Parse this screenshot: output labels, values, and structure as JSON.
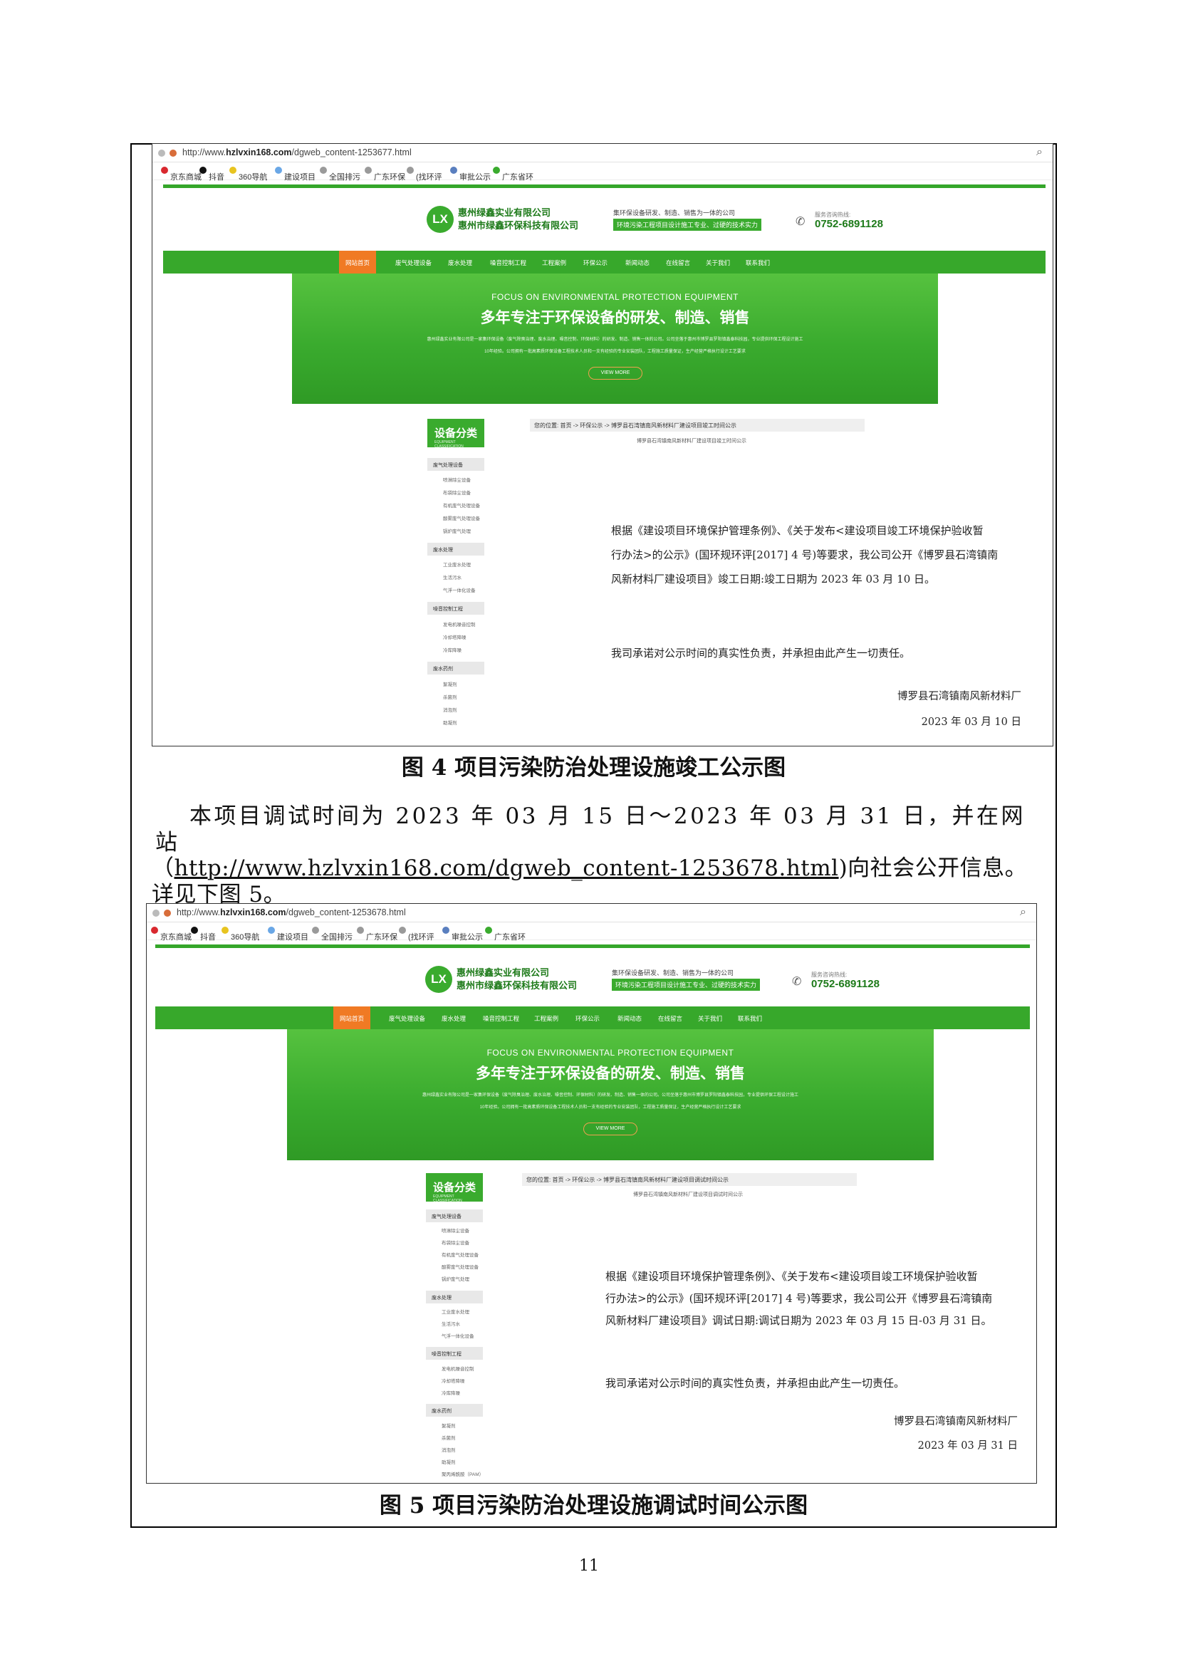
{
  "fig4": {
    "url_prefix": "http://www.",
    "url_domain": "hzlvxin168.com",
    "url_path": "/dgweb_content-1253677.html",
    "company_name_1": "惠州绿鑫实业有限公司",
    "company_name_2": "惠州市绿鑫环保科技有限公司",
    "slogan": "集环保设备研发、制造、销售为一体的公司",
    "slogan_bar": "环境污染工程项目设计施工专业、过硬的技术实力",
    "phone_label": "服务咨询热线:",
    "phone": "0752-6891128",
    "banner_en": "FOCUS ON ENVIRONMENTAL PROTECTION EQUIPMENT",
    "banner_cn": "多年专注于环保设备的研发、制造、销售",
    "view_more": "VIEW MORE",
    "crumb": "您的位置: 首页 -> 环保公示 -> 博罗县石湾镇南风新材料厂建设项目竣工时间公示",
    "subtitle": "博罗县石湾镇南风新材料厂建设项目竣工时间公示",
    "notice_1": "根据《建设项目环境保护管理条例》、《关于发布<建设项目竣工环境保护验收暂",
    "notice_2": "行办法>的公示》(国环规环评[2017] 4 号)等要求，我公司公开《博罗县石湾镇南",
    "notice_3": "风新材料厂建设项目》竣工日期:竣工日期为 2023 年 03 月 10 日。",
    "promise": "我司承诺对公示时间的真实性负责，并承担由此产生一切责任。",
    "sign_company": "博罗县石湾镇南风新材料厂",
    "sign_date": "2023 年 03 月 10 日",
    "caption": "图 4 项目污染防治处理设施竣工公示图"
  },
  "fig5": {
    "url_prefix": "http://www.",
    "url_domain": "hzlvxin168.com",
    "url_path": "/dgweb_content-1253678.html",
    "company_name_1": "惠州绿鑫实业有限公司",
    "company_name_2": "惠州市绿鑫环保科技有限公司",
    "slogan": "集环保设备研发、制造、销售为一体的公司",
    "slogan_bar": "环境污染工程项目设计施工专业、过硬的技术实力",
    "phone_label": "服务咨询热线:",
    "phone": "0752-6891128",
    "banner_en": "FOCUS ON ENVIRONMENTAL PROTECTION EQUIPMENT",
    "banner_cn": "多年专注于环保设备的研发、制造、销售",
    "view_more": "VIEW MORE",
    "crumb": "您的位置: 首页 -> 环保公示 -> 博罗县石湾镇南风新材料厂建设项目调试时间公示",
    "subtitle": "博罗县石湾镇南风新材料厂建设项目调试时间公示",
    "notice_1": "根据《建设项目环境保护管理条例》、《关于发布<建设项目竣工环境保护验收暂",
    "notice_2": "行办法>的公示》(国环规环评[2017] 4 号)等要求，我公司公开《博罗县石湾镇南",
    "notice_3": "风新材料厂建设项目》调试日期:调试日期为 2023 年 03 月 15 日-03 月 31 日。",
    "promise": "我司承诺对公示时间的真实性负责，并承担由此产生一切责任。",
    "sign_company": "博罗县石湾镇南风新材料厂",
    "sign_date": "2023 年 03 月 31 日",
    "caption": "图 5 项目污染防治处理设施调试时间公示图"
  },
  "bookmarks": [
    "京东商城",
    "抖音",
    "360导航",
    "建设项目",
    "全国排污",
    "广东环保",
    "(找环评",
    "审批公示",
    "广东省环"
  ],
  "nav_items": [
    "网站首页",
    "废气处理设备",
    "废水处理",
    "噪音控制工程",
    "工程案例",
    "环保公示",
    "新闻动态",
    "在线留言",
    "关于我们",
    "联系我们"
  ],
  "banner_desc_1": "惠州绿鑫实业有限公司是一家集环保设备（废气除臭治理、废水治理、噪音控制、环保材料）的研发、制造、销售一体的公司。公司坐落于惠州市博罗县罗阳镇鑫泰科技园，专业提供环保工程设计施工",
  "banner_desc_2": "10年经验。公司拥有一批高素质环保设备工程技术人员和一支有经验的专业安装团队，工程施工质量保证，生产经营严格执行设计工艺要求",
  "sidebar": {
    "title": "设备分类",
    "subtitle": "EQUIPMENT CLASSIFICATION",
    "categories": [
      {
        "name": "废气处理设备",
        "items": [
          "喷淋除尘设备",
          "布袋除尘设备",
          "有机废气处理设备",
          "酸雾废气处理设备",
          "锅炉废气处理"
        ]
      },
      {
        "name": "废水处理",
        "items": [
          "工业废水处理",
          "生活污水",
          "气浮一体化设备"
        ]
      },
      {
        "name": "噪音控制工程",
        "items": [
          "发电机噪音控制",
          "冷却塔降噪",
          "冷库降噪"
        ]
      },
      {
        "name": "废水药剂",
        "items": [
          "絮凝剂",
          "杀菌剂",
          "消泡剂",
          "助凝剂"
        ]
      }
    ],
    "extra_item_fig5": "聚丙烯酰胺（PAM）"
  },
  "para": {
    "line1": "本项目调试时间为 2023 年 03 月 15 日～2023 年 03 月 31 日，并在网站",
    "link": "http://www.hzlvxin168.com/dgweb_content-1253678.html",
    "line2_open": "（",
    "line2_suffix": ")向社会公开信息。详见下图 5。"
  },
  "page_number": "11"
}
